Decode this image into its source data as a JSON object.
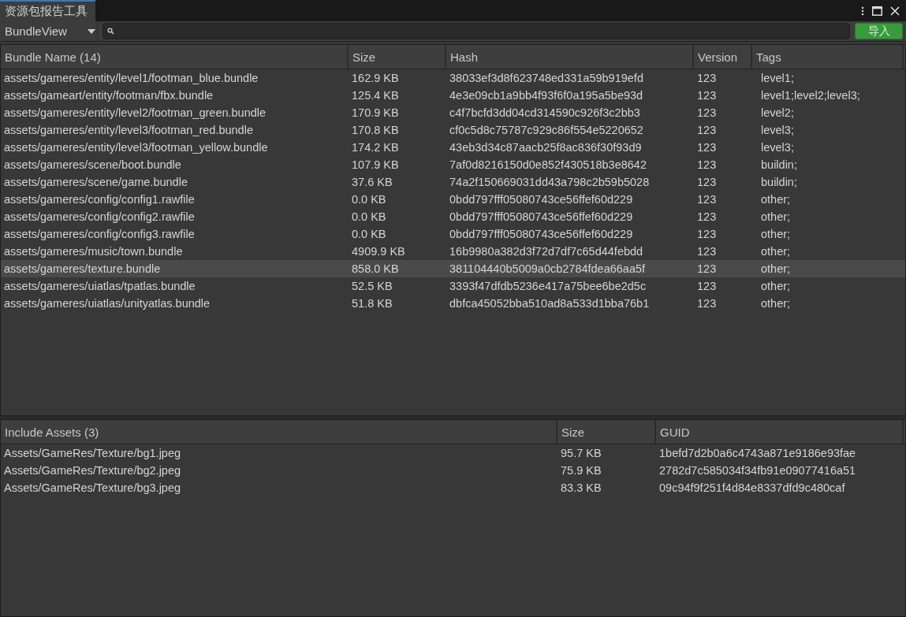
{
  "window": {
    "title": "资源包报告工具"
  },
  "toolbar": {
    "view_dropdown": "BundleView",
    "import_button": "导入"
  },
  "bundle_table": {
    "columns": [
      "Bundle Name (14)",
      "Size",
      "Hash",
      "Version",
      "Tags"
    ],
    "rows": [
      {
        "cells": [
          "assets/gameres/entity/level1/footman_blue.bundle",
          "162.9 KB",
          "38033ef3d8f623748ed331a59b919efd",
          "123",
          "level1;"
        ],
        "selected": false
      },
      {
        "cells": [
          "assets/gameart/entity/footman/fbx.bundle",
          "125.4 KB",
          "4e3e09cb1a9bb4f93f6f0a195a5be93d",
          "123",
          "level1;level2;level3;"
        ],
        "selected": false
      },
      {
        "cells": [
          "assets/gameres/entity/level2/footman_green.bundle",
          "170.9 KB",
          "c4f7bcfd3dd04cd314590c926f3c2bb3",
          "123",
          "level2;"
        ],
        "selected": false
      },
      {
        "cells": [
          "assets/gameres/entity/level3/footman_red.bundle",
          "170.8 KB",
          "cf0c5d8c75787c929c86f554e5220652",
          "123",
          "level3;"
        ],
        "selected": false
      },
      {
        "cells": [
          "assets/gameres/entity/level3/footman_yellow.bundle",
          "174.2 KB",
          "43eb3d34c87aacb25f8ac836f30f93d9",
          "123",
          "level3;"
        ],
        "selected": false
      },
      {
        "cells": [
          "assets/gameres/scene/boot.bundle",
          "107.9 KB",
          "7af0d8216150d0e852f430518b3e8642",
          "123",
          "buildin;"
        ],
        "selected": false
      },
      {
        "cells": [
          "assets/gameres/scene/game.bundle",
          "37.6 KB",
          "74a2f150669031dd43a798c2b59b5028",
          "123",
          "buildin;"
        ],
        "selected": false
      },
      {
        "cells": [
          "assets/gameres/config/config1.rawfile",
          "0.0 KB",
          "0bdd797fff05080743ce56ffef60d229",
          "123",
          "other;"
        ],
        "selected": false
      },
      {
        "cells": [
          "assets/gameres/config/config2.rawfile",
          "0.0 KB",
          "0bdd797fff05080743ce56ffef60d229",
          "123",
          "other;"
        ],
        "selected": false
      },
      {
        "cells": [
          "assets/gameres/config/config3.rawfile",
          "0.0 KB",
          "0bdd797fff05080743ce56ffef60d229",
          "123",
          "other;"
        ],
        "selected": false
      },
      {
        "cells": [
          "assets/gameres/music/town.bundle",
          "4909.9 KB",
          "16b9980a382d3f72d7df7c65d44febdd",
          "123",
          "other;"
        ],
        "selected": false
      },
      {
        "cells": [
          "assets/gameres/texture.bundle",
          "858.0 KB",
          "381104440b5009a0cb2784fdea66aa5f",
          "123",
          "other;"
        ],
        "selected": true
      },
      {
        "cells": [
          "assets/gameres/uiatlas/tpatlas.bundle",
          "52.5 KB",
          "3393f47dfdb5236e417a75bee6be2d5c",
          "123",
          "other;"
        ],
        "selected": false
      },
      {
        "cells": [
          "assets/gameres/uiatlas/unityatlas.bundle",
          "51.8 KB",
          "dbfca45052bba510ad8a533d1bba76b1",
          "123",
          "other;"
        ],
        "selected": false
      }
    ]
  },
  "assets_table": {
    "columns": [
      "Include Assets (3)",
      "Size",
      "GUID"
    ],
    "rows": [
      {
        "cells": [
          "Assets/GameRes/Texture/bg1.jpeg",
          "95.7 KB",
          "1befd7d2b0a6c4743a871e9186e93fae"
        ]
      },
      {
        "cells": [
          "Assets/GameRes/Texture/bg2.jpeg",
          "75.9 KB",
          "2782d7c585034f34fb91e09077416a51"
        ]
      },
      {
        "cells": [
          "Assets/GameRes/Texture/bg3.jpeg",
          "83.3 KB",
          "09c94f9f251f4d84e8337dfd9c480caf"
        ]
      }
    ]
  }
}
